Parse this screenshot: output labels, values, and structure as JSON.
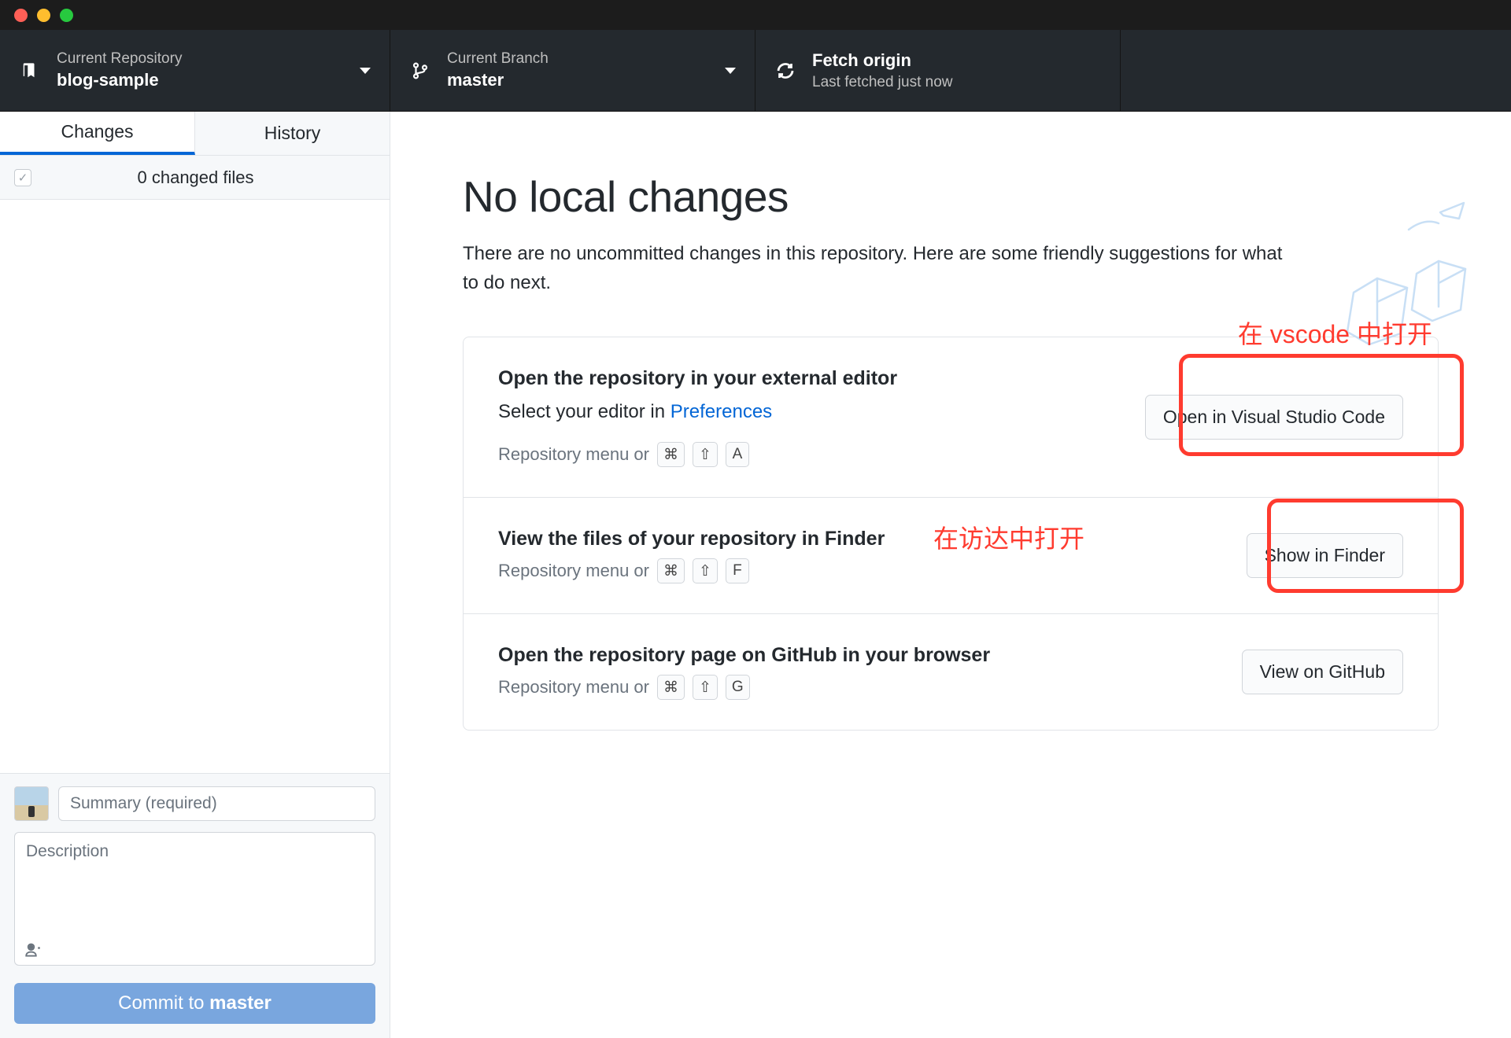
{
  "toolbar": {
    "repo": {
      "label": "Current Repository",
      "value": "blog-sample"
    },
    "branch": {
      "label": "Current Branch",
      "value": "master"
    },
    "fetch": {
      "label": "Fetch origin",
      "sub": "Last fetched just now"
    }
  },
  "sidebar": {
    "tabs": {
      "changes": "Changes",
      "history": "History"
    },
    "changed_files": "0 changed files",
    "summary_ph": "Summary (required)",
    "desc_ph": "Description",
    "commit_prefix": "Commit to ",
    "commit_branch": "master"
  },
  "content": {
    "title": "No local changes",
    "lead": "There are no uncommitted changes in this repository. Here are some friendly suggestions for what to do next.",
    "cards": [
      {
        "title": "Open the repository in your external editor",
        "text_pre": "Select your editor in ",
        "link": "Preferences",
        "hint_pre": "Repository menu or",
        "keys": [
          "⌘",
          "⇧",
          "A"
        ],
        "button": "Open in Visual Studio Code"
      },
      {
        "title": "View the files of your repository in Finder",
        "hint_pre": "Repository menu or",
        "keys": [
          "⌘",
          "⇧",
          "F"
        ],
        "button": "Show in Finder"
      },
      {
        "title": "Open the repository page on GitHub in your browser",
        "hint_pre": "Repository menu or",
        "keys": [
          "⌘",
          "⇧",
          "G"
        ],
        "button": "View on GitHub"
      }
    ]
  },
  "annotations": {
    "vscode": "在 vscode 中打开",
    "finder": "在访达中打开"
  }
}
